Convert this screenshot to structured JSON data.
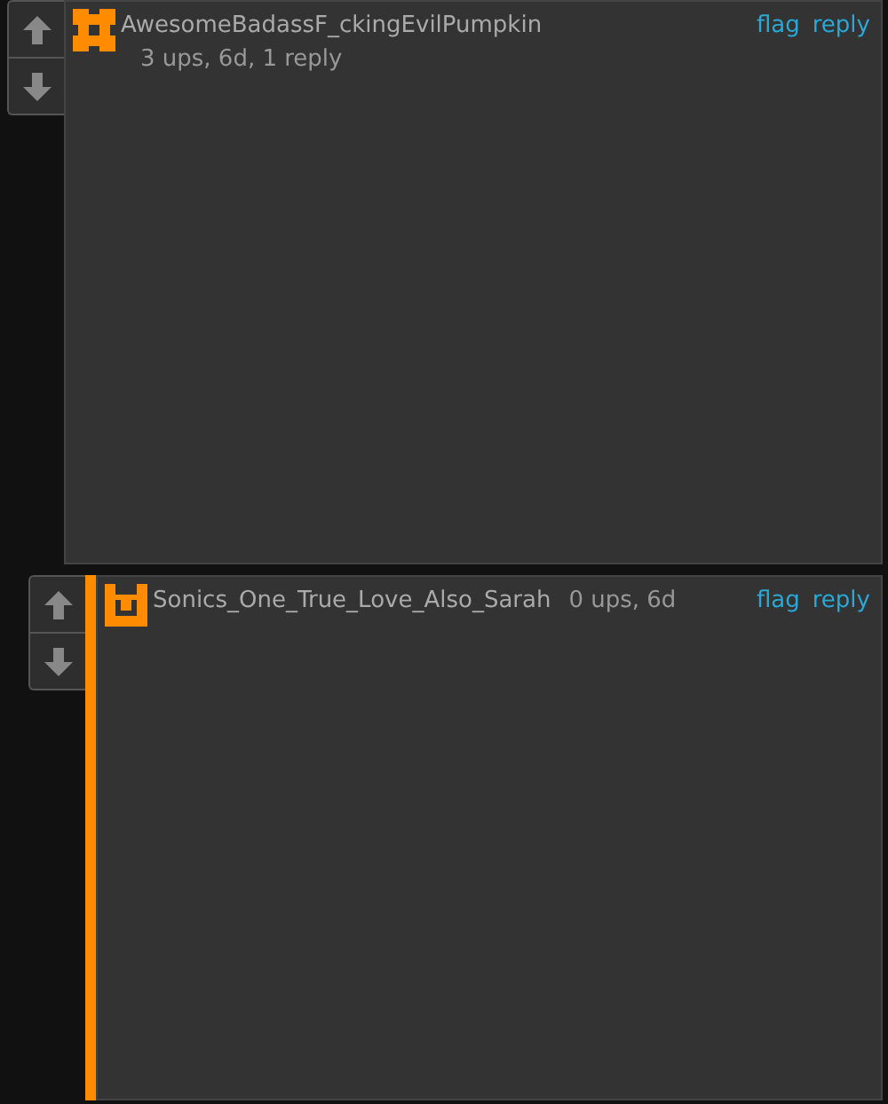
{
  "comments": [
    {
      "username": "AwesomeBadassF_ckingEvilPumpkin",
      "meta": "3 ups, 6d, 1 reply",
      "actions": [
        "flag",
        "reply"
      ],
      "children": [
        {
          "username": "Sonics_One_True_Love_Also_Sarah",
          "meta": "0 ups, 6d",
          "actions": [
            "flag",
            "reply"
          ]
        }
      ]
    }
  ]
}
